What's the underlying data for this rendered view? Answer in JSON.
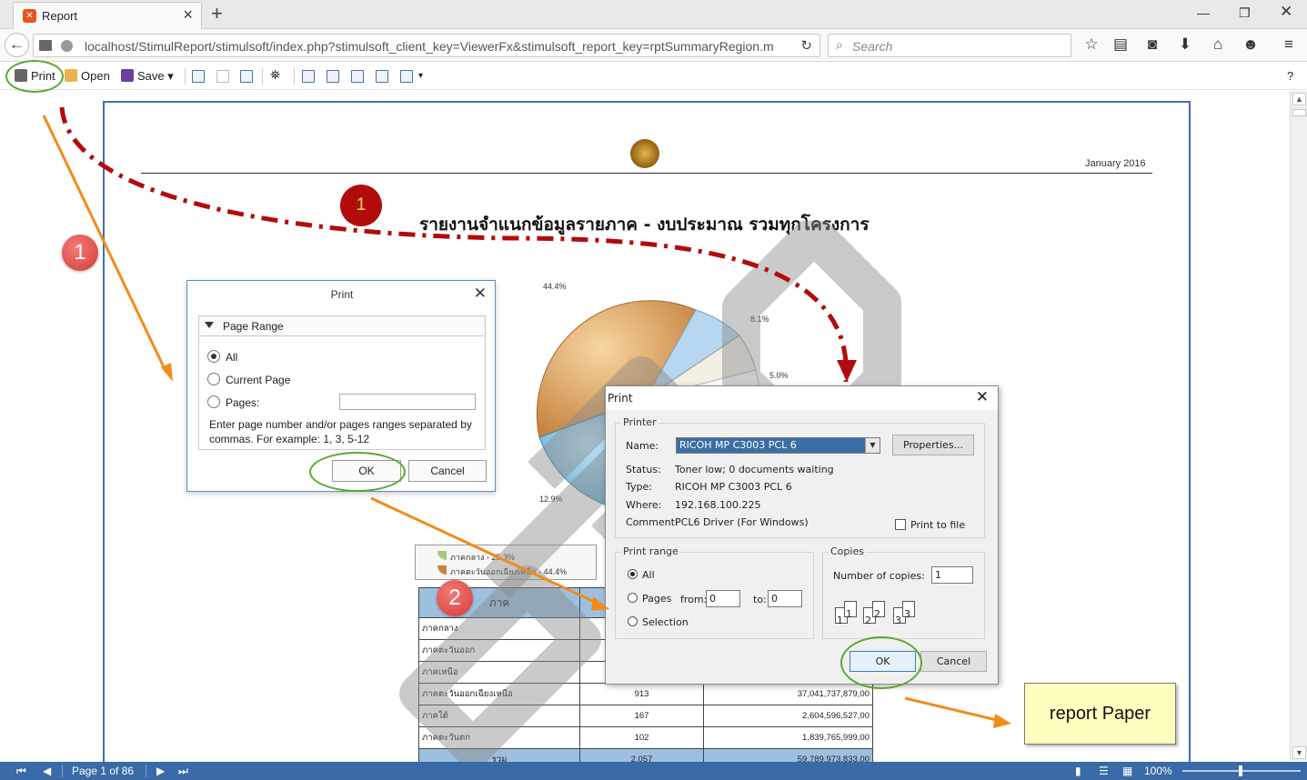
{
  "browser": {
    "tab_title": "Report",
    "url": "localhost/StimulReport/stimulsoft/index.php?stimulsoft_client_key=ViewerFx&stimulsoft_report_key=rptSummaryRegion.m",
    "search_placeholder": "Search"
  },
  "toolbar": {
    "print": "Print",
    "open": "Open",
    "save": "Save",
    "help": "?"
  },
  "report": {
    "date": "January 2016",
    "title": "รายงานจำแนกข้อมูลรายภาค - งบประมาณ รวมทุกโครงการ",
    "pie_labels": [
      "44.4%",
      "8.1%",
      "5.0%",
      "12.9%"
    ],
    "legend": [
      "ภาคกลาง - 25.3%",
      "ภาคตะวันออกเฉียงเหนือ - 44.4%"
    ],
    "table": {
      "header": [
        "ภาค",
        "",
        ""
      ],
      "rows": [
        [
          "ภาคกลาง",
          "",
          ""
        ],
        [
          "ภาคตะวันออก",
          "",
          ""
        ],
        [
          "ภาคเหนือ",
          "",
          ""
        ],
        [
          "ภาคตะวันออกเฉียงเหนือ",
          "913",
          "37,041,737,879,00"
        ],
        [
          "ภาคใต้",
          "167",
          "2,604,596,527,00"
        ],
        [
          "ภาคตะวันตก",
          "102",
          "1,839,765,999,00"
        ]
      ],
      "total": [
        "รวม",
        "2,057",
        "59,789,973,833,00"
      ]
    }
  },
  "print_dialog": {
    "title": "Print",
    "section": "Page Range",
    "option_all": "All",
    "option_current": "Current Page",
    "option_pages": "Pages:",
    "hint": "Enter page number and/or pages ranges separated by commas. For example: 1, 3, 5-12",
    "ok": "OK",
    "cancel": "Cancel"
  },
  "win_print": {
    "title": "Print",
    "printer_group": "Printer",
    "name_label": "Name:",
    "name_value": "RICOH MP C3003 PCL 6",
    "properties": "Properties...",
    "status_label": "Status:",
    "status_value": "Toner low; 0 documents waiting",
    "type_label": "Type:",
    "type_value": "RICOH MP C3003 PCL 6",
    "where_label": "Where:",
    "where_value": "192.168.100.225",
    "comment_label": "Comment:",
    "comment_value": "PCL6 Driver (For Windows)",
    "print_to_file": "Print to file",
    "range_group": "Print range",
    "all": "All",
    "pages": "Pages",
    "from_label": "from:",
    "from_value": "0",
    "to_label": "to:",
    "to_value": "0",
    "selection": "Selection",
    "copies_group": "Copies",
    "copies_label": "Number of copies:",
    "copies_value": "1",
    "ok": "OK",
    "cancel": "Cancel"
  },
  "annotations": {
    "step1": "1",
    "step2": "2",
    "step_dark": "1",
    "note": "report Paper"
  },
  "statusbar": {
    "page_info": "Page 1 of 86",
    "zoom": "100%"
  },
  "colors": {
    "accent": "#3a6aa8",
    "annotation_ring": "#5aa830",
    "annotation_arrow": "#f28a1c",
    "dash_arrow": "#b20b0b"
  }
}
